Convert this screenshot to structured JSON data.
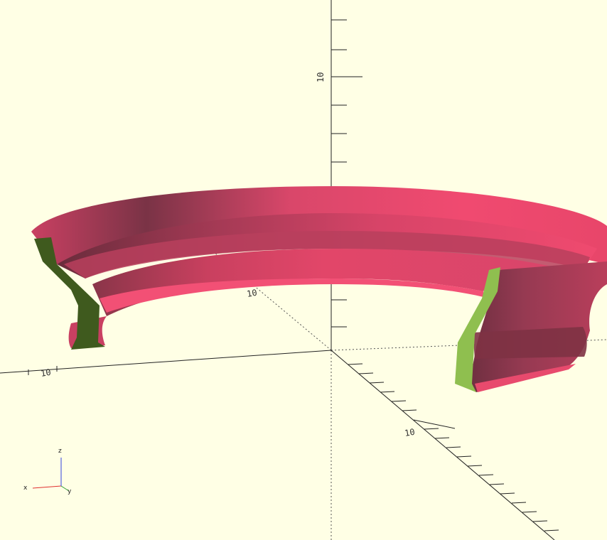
{
  "viewport": {
    "background": "#ffffe5",
    "model_color": "#e8466a",
    "cut_face_color_front": "#8fbf4f",
    "cut_face_color_back": "#3f5a1e"
  },
  "axes": {
    "z_positive_tick_label": "10",
    "x_negative_tick_label": "10",
    "y_negative_tick_label": "10",
    "origin_tick_label": "10"
  },
  "gizmo": {
    "x_label": "x",
    "y_label": "y",
    "z_label": "z",
    "x_color": "#e03030",
    "y_color": "#30a030",
    "z_color": "#3040e0"
  }
}
